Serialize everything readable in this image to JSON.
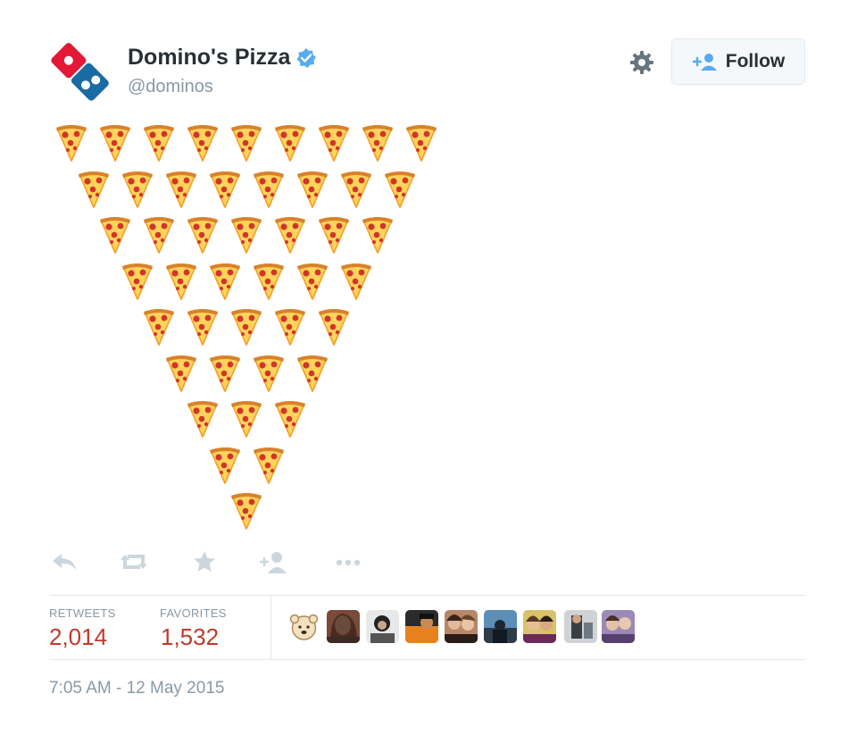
{
  "account": {
    "name": "Domino's Pizza",
    "handle": "@dominos",
    "verified": true
  },
  "header": {
    "settings_icon": "gear-icon",
    "follow_label": "Follow"
  },
  "tweet": {
    "content_emoji": "pizza",
    "rows": [
      9,
      8,
      7,
      6,
      5,
      4,
      3,
      2,
      1
    ],
    "total_emoji": 45
  },
  "actions": [
    {
      "name": "reply-icon"
    },
    {
      "name": "retweet-icon"
    },
    {
      "name": "favorite-icon"
    },
    {
      "name": "follow-icon"
    },
    {
      "name": "more-icon"
    }
  ],
  "stats": {
    "retweets_label": "RETWEETS",
    "retweets_count": "2,014",
    "favorites_label": "FAVORITES",
    "favorites_count": "1,532"
  },
  "favoriters_count_shown": 9,
  "timestamp": "7:05 AM - 12 May 2015",
  "colors": {
    "count": "#c0392b",
    "muted": "#8899a6",
    "brand_blue": "#1a6ba3",
    "brand_red": "#e31837",
    "verified": "#55acee"
  }
}
